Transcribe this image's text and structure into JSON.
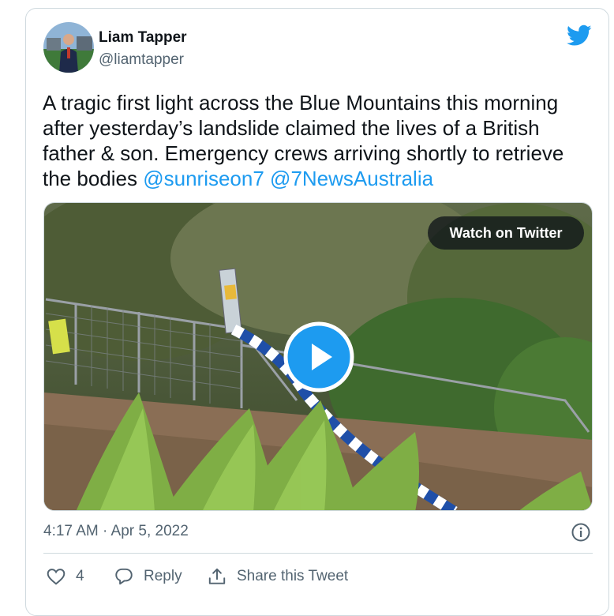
{
  "author": {
    "name": "Liam Tapper",
    "handle": "@liamtapper"
  },
  "tweet": {
    "text": "A tragic first light across the Blue Mountains this morning after yesterday’s landslide claimed the lives of a British father & son. Emergency crews arriving shortly to retrieve the bodies ",
    "mentions": [
      "@sunriseon7",
      "@7NewsAustralia"
    ]
  },
  "media": {
    "watch_label": "Watch on Twitter"
  },
  "meta": {
    "timestamp": "4:17 AM · Apr 5, 2022"
  },
  "actions": {
    "like_count": "4",
    "reply_label": "Reply",
    "share_label": "Share this Tweet"
  },
  "colors": {
    "accent": "#1d9bf0",
    "text": "#0f1419",
    "secondary": "#536471",
    "border": "#cfd9de"
  }
}
